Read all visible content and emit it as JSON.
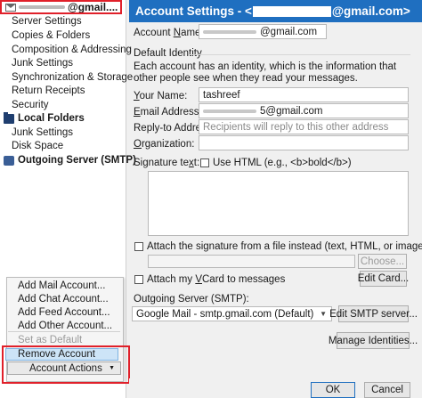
{
  "left_pane": {
    "account_label": "@gmail....",
    "items": [
      "Server Settings",
      "Copies & Folders",
      "Composition & Addressing",
      "Junk Settings",
      "Synchronization & Storage",
      "Return Receipts",
      "Security"
    ],
    "local_folders": {
      "label": "Local Folders",
      "items": [
        "Junk Settings",
        "Disk Space"
      ]
    },
    "outgoing_server": "Outgoing Server (SMTP)"
  },
  "menu": {
    "items": [
      "Add Mail Account...",
      "Add Chat Account...",
      "Add Feed Account...",
      "Add Other Account..."
    ],
    "set_default": "Set as Default",
    "remove": "Remove Account",
    "actions": "Account Actions",
    "actions_caret": "▼"
  },
  "header": {
    "title_prefix": "Account Settings - <",
    "title_suffix": "@gmail.com>"
  },
  "account_name": {
    "label_pre": "Account ",
    "label_u": "N",
    "label_post": "ame:",
    "value": "@gmail.com"
  },
  "identity": {
    "group_label": "Default Identity",
    "description": "Each account has an identity, which is the information that other people see when they read your messages.",
    "your_name": {
      "label_u": "Y",
      "label_post": "our Name:",
      "value": "tashreef"
    },
    "email": {
      "label_u": "E",
      "label_post": "mail Address:",
      "value": "5@gmail.com"
    },
    "reply_to": {
      "label": "Reply-to Address:",
      "placeholder": "Recipients will reply to this other address"
    },
    "organization": {
      "label_u": "O",
      "label_post": "rganization:",
      "value": ""
    },
    "signature_label": "Signature te",
    "signature_u": "x",
    "signature_end": "t:",
    "use_html": "Use HTML (e.g., <b>bold</b>)",
    "attach_signature": "Attach the signature from a file instead (text, HTML, or image):",
    "choose_btn": "Choose...",
    "attach_vcard_pre": "Attach my ",
    "attach_vcard_u": "V",
    "attach_vcard_post": "Card to messages",
    "edit_card_btn": "Edit Card...",
    "smtp_label": "Outgoing Server (SMTP):",
    "smtp_value": "Google Mail - smtp.gmail.com (Default)",
    "edit_smtp_btn": "Edit SMTP server...",
    "manage_identities_btn": "Manage Identities..."
  },
  "footer": {
    "ok": "OK",
    "cancel": "Cancel"
  },
  "colors": {
    "title_bar": "#1f6fc0",
    "highlight": "#e0202a",
    "selected": "#cde4f7"
  }
}
